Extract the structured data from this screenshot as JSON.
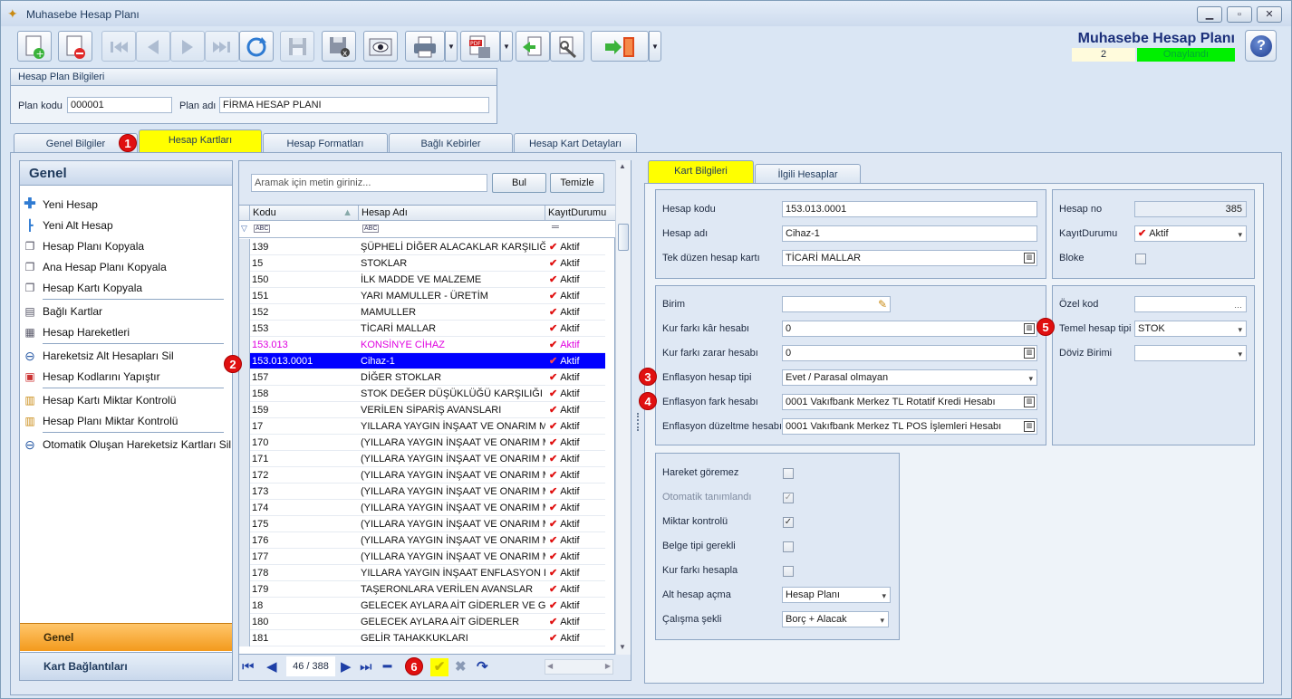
{
  "window": {
    "title": "Muhasebe Hesap Planı",
    "app_heading": "Muhasebe Hesap Planı",
    "record_number": "2",
    "status": "Onaylandı"
  },
  "toolbar": {
    "icons": [
      "new-document-icon",
      "delete-document-icon",
      "first-record-icon",
      "previous-record-icon",
      "next-record-icon",
      "last-record-icon",
      "refresh-icon",
      "save-icon",
      "save-close-icon",
      "preview-icon",
      "print-icon",
      "pdf-export-icon",
      "import-icon",
      "tools-icon",
      "exit-icon",
      "help-icon"
    ]
  },
  "plan_info": {
    "header": "Hesap Plan Bilgileri",
    "code_label": "Plan kodu",
    "code_value": "000001",
    "name_label": "Plan adı",
    "name_value": "FİRMA HESAP PLANI"
  },
  "main_tabs": [
    "Genel Bilgiler",
    "Hesap Kartları",
    "Hesap Formatları",
    "Bağlı Kebirler",
    "Hesap Kart Detayları"
  ],
  "left_panel": {
    "header": "Genel",
    "items": [
      "Yeni Hesap",
      "Yeni Alt Hesap",
      "Hesap Planı Kopyala",
      "Ana Hesap Planı Kopyala",
      "Hesap Kartı Kopyala",
      "Bağlı Kartlar",
      "Hesap Hareketleri",
      "Hareketsiz Alt Hesapları Sil",
      "Hesap Kodlarını Yapıştır",
      "Hesap Kartı Miktar Kontrolü",
      "Hesap Planı Miktar Kontrolü",
      "Otomatik Oluşan Hareketsiz Kartları Sil"
    ],
    "footer_active": "Genel",
    "footer_other": "Kart Bağlantıları"
  },
  "search": {
    "placeholder": "Aramak için metin giriniz...",
    "find_button": "Bul",
    "clear_button": "Temizle"
  },
  "grid": {
    "columns": [
      "Kodu",
      "Hesap Adı",
      "KayıtDurumu"
    ],
    "rows": [
      {
        "code": "139",
        "name": "ŞÜPHELİ DİĞER ALACAKLAR KARŞILIĞI (-)",
        "status": "Aktif"
      },
      {
        "code": "15",
        "name": "STOKLAR",
        "status": "Aktif"
      },
      {
        "code": "150",
        "name": "İLK MADDE VE MALZEME",
        "status": "Aktif"
      },
      {
        "code": "151",
        "name": "YARI MAMULLER - ÜRETİM",
        "status": "Aktif"
      },
      {
        "code": "152",
        "name": "MAMULLER",
        "status": "Aktif"
      },
      {
        "code": "153",
        "name": "TİCARİ MALLAR",
        "status": "Aktif"
      },
      {
        "code": "153.013",
        "name": "KONSİNYE CİHAZ",
        "status": "Aktif"
      },
      {
        "code": "153.013.0001",
        "name": "Cihaz-1",
        "status": "Aktif"
      },
      {
        "code": "157",
        "name": "DİĞER STOKLAR",
        "status": "Aktif"
      },
      {
        "code": "158",
        "name": "STOK DEĞER DÜŞÜKLÜĞÜ KARŞILIĞI (-)",
        "status": "Aktif"
      },
      {
        "code": "159",
        "name": "VERİLEN SİPARİŞ AVANSLARI",
        "status": "Aktif"
      },
      {
        "code": "17",
        "name": "YILLARA YAYGIN İNŞAAT VE ONARIM MALİYETLERİ",
        "status": "Aktif"
      },
      {
        "code": "170",
        "name": "(YILLARA YAYGIN İNŞAAT VE ONARIM MALİYETLERİ)",
        "status": "Aktif"
      },
      {
        "code": "171",
        "name": "(YILLARA YAYGIN İNŞAAT VE ONARIM MALİYETLERİ)",
        "status": "Aktif"
      },
      {
        "code": "172",
        "name": "(YILLARA YAYGIN İNŞAAT VE ONARIM MALİYETLERİ)",
        "status": "Aktif"
      },
      {
        "code": "173",
        "name": "(YILLARA YAYGIN İNŞAAT VE ONARIM MALİYETLERİ)",
        "status": "Aktif"
      },
      {
        "code": "174",
        "name": "(YILLARA YAYGIN İNŞAAT VE ONARIM MALİYETLERİ)",
        "status": "Aktif"
      },
      {
        "code": "175",
        "name": "(YILLARA YAYGIN İNŞAAT VE ONARIM MALİYETLERİ)",
        "status": "Aktif"
      },
      {
        "code": "176",
        "name": "(YILLARA YAYGIN İNŞAAT VE ONARIM MALİYETLERİ)",
        "status": "Aktif"
      },
      {
        "code": "177",
        "name": "(YILLARA YAYGIN İNŞAAT VE ONARIM MALİYETLERİ)",
        "status": "Aktif"
      },
      {
        "code": "178",
        "name": "YILLARA YAYGIN İNŞAAT ENFLASYON DÜZELTME HESABI",
        "status": "Aktif"
      },
      {
        "code": "179",
        "name": "TAŞERONLARA VERİLEN AVANSLAR",
        "status": "Aktif"
      },
      {
        "code": "18",
        "name": "GELECEK AYLARA AİT GİDERLER VE GELİR TAHAKKUKLARI",
        "status": "Aktif"
      },
      {
        "code": "180",
        "name": "GELECEK AYLARA AİT GİDERLER",
        "status": "Aktif"
      },
      {
        "code": "181",
        "name": "GELİR TAHAKKUKLARI",
        "status": "Aktif"
      }
    ],
    "pager": "46 / 388"
  },
  "detail_tabs": [
    "Kart Bilgileri",
    "İlgili Hesaplar"
  ],
  "card": {
    "hesap_kodu": {
      "label": "Hesap kodu",
      "value": "153.013.0001"
    },
    "hesap_adi": {
      "label": "Hesap adı",
      "value": "Cihaz-1"
    },
    "tek_duzen": {
      "label": "Tek düzen hesap kartı",
      "value": "TİCARİ MALLAR"
    },
    "hesap_no": {
      "label": "Hesap no",
      "value": "385"
    },
    "kayit_durumu": {
      "label": "KayıtDurumu",
      "value": "Aktif"
    },
    "bloke": {
      "label": "Bloke"
    },
    "birim": {
      "label": "Birim",
      "value": ""
    },
    "kur_kar": {
      "label": "Kur farkı kâr hesabı",
      "value": "0"
    },
    "kur_zarar": {
      "label": "Kur farkı zarar hesabı",
      "value": "0"
    },
    "enf_tipi": {
      "label": "Enflasyon hesap tipi",
      "value": "Evet / Parasal olmayan"
    },
    "enf_fark": {
      "label": "Enflasyon fark hesabı",
      "value": "0001 Vakıfbank Merkez TL Rotatif Kredi Hesabı"
    },
    "enf_duzeltme": {
      "label": "Enflasyon düzeltme hesabı",
      "value": "0001 Vakıfbank Merkez TL POS İşlemleri Hesabı"
    },
    "ozel_kod": {
      "label": "Özel kod",
      "value": ""
    },
    "temel_tip": {
      "label": "Temel hesap tipi",
      "value": "STOK"
    },
    "doviz": {
      "label": "Döviz Birimi",
      "value": ""
    },
    "hareket_goremez": {
      "label": "Hareket göremez",
      "checked": false
    },
    "otomatik": {
      "label": "Otomatik tanımlandı",
      "checked": true
    },
    "miktar": {
      "label": "Miktar kontrolü",
      "checked": true
    },
    "belge_tipi": {
      "label": "Belge tipi gerekli",
      "checked": false
    },
    "kur_farki_hesapla": {
      "label": "Kur farkı hesapla",
      "checked": false
    },
    "alt_hesap": {
      "label": "Alt hesap açma",
      "value": "Hesap Planı"
    },
    "calisma": {
      "label": "Çalışma şekli",
      "value": "Borç + Alacak"
    }
  },
  "callouts": [
    "1",
    "2",
    "3",
    "4",
    "5",
    "6"
  ],
  "colors": {
    "highlight": "#ffff00",
    "selected_row": "#0000ff",
    "callout": "#e01010",
    "status_badge": "#00f000",
    "pink_row": "#e000e0"
  }
}
